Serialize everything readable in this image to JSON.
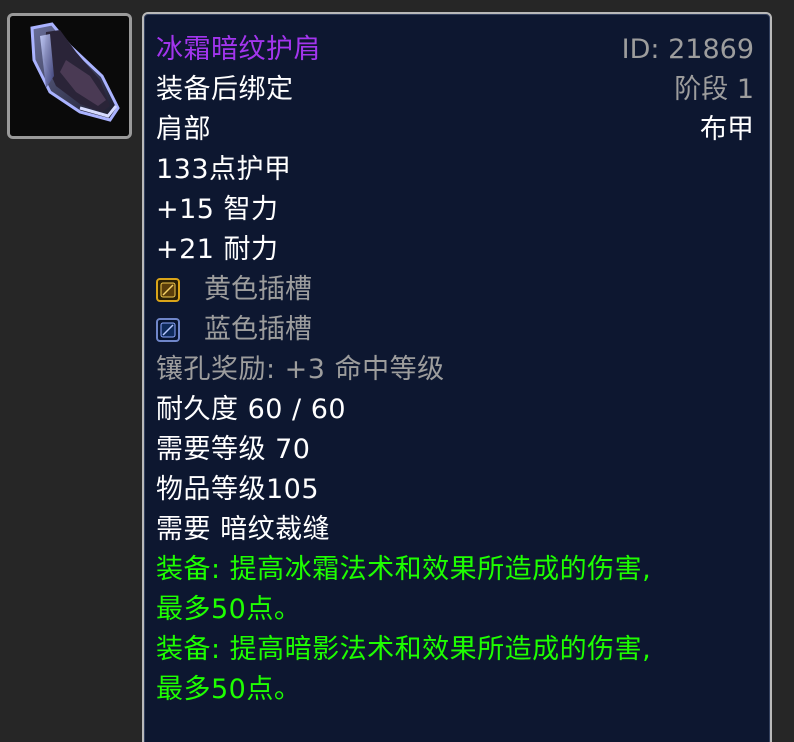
{
  "item": {
    "name": "冰霜暗纹护肩",
    "binding": "装备后绑定",
    "slot": "肩部",
    "armor_type": "布甲",
    "armor": "133点护甲",
    "stat_int": "+15 智力",
    "stat_sta": "+21 耐力",
    "socket_yellow": "黄色插槽",
    "socket_blue": "蓝色插槽",
    "socket_bonus": "镶孔奖励: +3 命中等级",
    "durability": "耐久度 60 / 60",
    "required_level": "需要等级 70",
    "item_level": "物品等级105",
    "required_profession": "需要 暗纹裁缝",
    "equip1_line1": "装备: 提高冰霜法术和效果所造成的伤害,",
    "equip1_line2": "最多50点。",
    "equip2_line1": "装备: 提高暗影法术和效果所造成的伤害,",
    "equip2_line2": "最多50点。"
  },
  "meta": {
    "id_text": "ID: 21869",
    "phase_text": "阶段 1"
  },
  "icons": {
    "item_icon": "shoulder-armor-icon",
    "yellow_socket": "yellow-socket-icon",
    "blue_socket": "blue-socket-icon"
  },
  "colors": {
    "epic_purple": "#a335ee",
    "equip_green": "#1eff00",
    "muted_gray": "#9d9d9d",
    "tooltip_bg": "#0d1730"
  }
}
